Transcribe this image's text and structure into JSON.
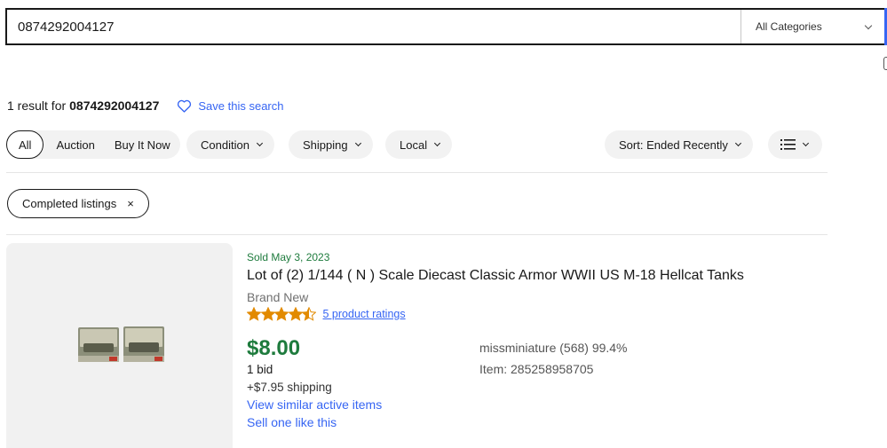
{
  "search": {
    "query": "0874292004127",
    "category": "All Categories"
  },
  "results": {
    "count_text": "1 result for",
    "query": "0874292004127",
    "save_search": "Save this search"
  },
  "filters": {
    "all": "All",
    "auction": "Auction",
    "buy_it_now": "Buy It Now",
    "condition": "Condition",
    "shipping": "Shipping",
    "local": "Local",
    "sort": "Sort: Ended Recently"
  },
  "active_filter": {
    "label": "Completed listings",
    "remove": "×"
  },
  "listing": {
    "sold_date": "Sold May 3, 2023",
    "title": "Lot of (2) 1/144 ( N ) Scale Diecast Classic Armor WWII US M-18 Hellcat Tanks",
    "condition": "Brand New",
    "rating_value": 4.5,
    "ratings_link": "5 product ratings",
    "price": "$8.00",
    "bids": "1 bid",
    "shipping": "+$7.95 shipping",
    "view_similar": "View similar active items",
    "sell_one": "Sell one like this",
    "seller": "missminiature (568) 99.4%",
    "item_number": "Item: 285258958705"
  },
  "colors": {
    "accent_blue": "#3665f3",
    "price_green": "#1e7b3d",
    "star_orange": "#e28a00"
  }
}
